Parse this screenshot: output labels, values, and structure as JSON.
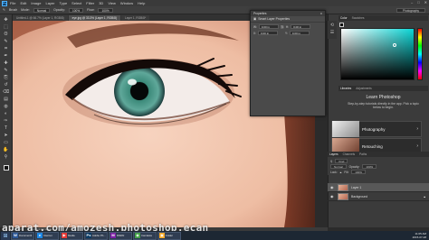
{
  "app": {
    "logo": "Ps",
    "menu": [
      "File",
      "Edit",
      "Image",
      "Layer",
      "Type",
      "Select",
      "Filter",
      "3D",
      "View",
      "Window",
      "Help"
    ],
    "window_controls": [
      "–",
      "□",
      "✕"
    ]
  },
  "options_bar": {
    "tool_label": "Brush",
    "mode_label": "Mode:",
    "mode_value": "Normal",
    "opacity_label": "Opacity:",
    "opacity_value": "100%",
    "flow_label": "Flow:",
    "flow_value": "100%",
    "workspace": "Photography"
  },
  "tabs": [
    {
      "label": "Untitled-1 @ 66.7% (Layer 1, RGB/8)",
      "active": false
    },
    {
      "label": "eye.jpg @ 33.3% (Layer 1, RGB/8)",
      "active": true
    },
    {
      "label": "Layer 1, RGB/8*",
      "active": false
    }
  ],
  "toolbar": {
    "tools": [
      "move-icon",
      "marquee-icon",
      "lasso-icon",
      "quick-select-icon",
      "crop-icon",
      "eyedropper-icon",
      "healing-icon",
      "brush-icon",
      "stamp-icon",
      "history-brush-icon",
      "eraser-icon",
      "gradient-icon",
      "blur-icon",
      "dodge-icon",
      "pen-icon",
      "type-icon",
      "path-select-icon",
      "shape-icon",
      "hand-icon",
      "zoom-icon"
    ],
    "glyphs": [
      "✥",
      "⬚",
      "ʘ",
      "✎",
      "⌗",
      "✒",
      "✚",
      "✎",
      "⎘",
      "↺",
      "⌫",
      "▤",
      "◍",
      "◐",
      "✑",
      "T",
      "➤",
      "▭",
      "✋",
      "⚲"
    ]
  },
  "properties": {
    "header": "Properties",
    "section": "Smart Layer Properties",
    "w_label": "W:",
    "w_value": "0.00 in",
    "h_label": "H:",
    "h_value": "0.00 in",
    "x_label": "X:",
    "x_value": "0.00 in",
    "y_label": "Y:",
    "y_value": "0.00 in"
  },
  "color_panel": {
    "tabs": [
      "Color",
      "Swatches"
    ],
    "hue_color": "#0bd6d6"
  },
  "library_tabs": [
    "Libraries",
    "Adjustments"
  ],
  "learn": {
    "title": "Learn Photoshop",
    "description": "Step-by-step tutorials directly in the app. Pick a topic below to begin.",
    "items": [
      {
        "label": "Photography"
      },
      {
        "label": "Retouching"
      }
    ]
  },
  "layers_panel": {
    "tabs": [
      "Layers",
      "Channels",
      "Paths"
    ],
    "kind_label": "Kind",
    "blend_mode": "Normal",
    "opacity_label": "Opacity:",
    "opacity_value": "100%",
    "lock_label": "Lock:",
    "fill_label": "Fill:",
    "fill_value": "100%",
    "layers": [
      {
        "name": "Layer 1",
        "active": true
      },
      {
        "name": "Background",
        "active": false
      }
    ]
  },
  "status": {
    "zoom": "33.33%",
    "doc": "Doc: 5.93M/11.9M"
  },
  "taskbar": {
    "items": [
      {
        "icon": "W",
        "label": "Document1",
        "color": "#2b5797"
      },
      {
        "icon": "e",
        "label": "Internet",
        "color": "#1e88e5"
      },
      {
        "icon": "▶",
        "label": "Media",
        "color": "#e53935"
      },
      {
        "icon": "Ps",
        "label": "Adobe Ph...",
        "color": "#0b3a63"
      },
      {
        "icon": "M",
        "label": "MSDN",
        "color": "#7b1fa2"
      },
      {
        "icon": "◉",
        "label": "Camtasia",
        "color": "#43a047"
      },
      {
        "icon": "▣",
        "label": "Folder",
        "color": "#f9a825"
      }
    ],
    "time": "11:05 AM",
    "date": "2015-07-28"
  },
  "watermark": "aparat.com/amozesh.photoshop.ecan"
}
